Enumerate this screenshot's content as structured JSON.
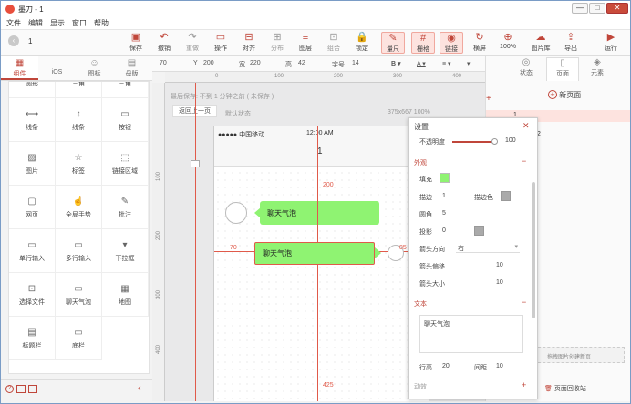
{
  "app": {
    "title": "墨刀 - 1"
  },
  "window_controls": {
    "minimize": "—",
    "maximize": "□",
    "close": "✕"
  },
  "menu": [
    "文件",
    "编辑",
    "显示",
    "窗口",
    "帮助"
  ],
  "nav": {
    "back_icon": "‹",
    "page_number": "1"
  },
  "toolbar": [
    {
      "label": "保存",
      "icon": "▣"
    },
    {
      "label": "撤销",
      "icon": "↶"
    },
    {
      "label": "重做",
      "icon": "↷"
    },
    {
      "label": "操作",
      "icon": "▭"
    },
    {
      "label": "对齐",
      "icon": "⊟"
    },
    {
      "label": "分布",
      "icon": "⊞"
    },
    {
      "label": "图层",
      "icon": "≡"
    },
    {
      "label": "组合",
      "icon": "⊡"
    },
    {
      "label": "锁定",
      "icon": "🔒"
    },
    {
      "label": "量尺",
      "icon": "✎"
    },
    {
      "label": "栅格",
      "icon": "#"
    },
    {
      "label": "链接",
      "icon": "◉"
    },
    {
      "label": "横屏",
      "icon": "↻"
    },
    {
      "label": "100%",
      "icon": "⊕"
    },
    {
      "label": "图片库",
      "icon": "☁"
    },
    {
      "label": "导出",
      "icon": "⇪"
    },
    {
      "label": "运行",
      "icon": "▶"
    }
  ],
  "left_tabs": [
    {
      "label": "组件",
      "icon": "▦"
    },
    {
      "label": "iOS",
      "icon": ""
    },
    {
      "label": "图标",
      "icon": "☺"
    },
    {
      "label": "母版",
      "icon": "▤"
    }
  ],
  "components": [
    {
      "label": "圆形",
      "icon": "○"
    },
    {
      "label": "三角",
      "icon": "△"
    },
    {
      "label": "三角",
      "icon": "▽"
    },
    {
      "label": "线条",
      "icon": "⟷"
    },
    {
      "label": "线条",
      "icon": "↕"
    },
    {
      "label": "按钮",
      "icon": "▭"
    },
    {
      "label": "图片",
      "icon": "▨"
    },
    {
      "label": "标签",
      "icon": "☆"
    },
    {
      "label": "链接区域",
      "icon": "⬚"
    },
    {
      "label": "网页",
      "icon": "▢"
    },
    {
      "label": "全局手势",
      "icon": "☝"
    },
    {
      "label": "批注",
      "icon": "✎"
    },
    {
      "label": "单行输入",
      "icon": "▭"
    },
    {
      "label": "多行输入",
      "icon": "▭"
    },
    {
      "label": "下拉框",
      "icon": "▾"
    },
    {
      "label": "选择文件",
      "icon": "⊡"
    },
    {
      "label": "聊天气泡",
      "icon": "▭"
    },
    {
      "label": "地图",
      "icon": "▦"
    },
    {
      "label": "标题栏",
      "icon": "▤"
    },
    {
      "label": "底栏",
      "icon": "▭"
    }
  ],
  "props": {
    "x": "70",
    "y_label": "Y",
    "y": "200",
    "w_label": "宽",
    "w": "220",
    "h_label": "高",
    "h": "42",
    "font_label": "字号",
    "font": "14"
  },
  "ruler_h_ticks": [
    "0",
    "100",
    "200",
    "300",
    "400"
  ],
  "ruler_v_ticks": [
    "100",
    "200",
    "300",
    "400"
  ],
  "canvas": {
    "saved": "最后保存: 不到 1 分钟之前 ( 未保存 )",
    "back_button": "返回上一页",
    "page_bg": "默认状态",
    "size": "375x667 100%"
  },
  "phone": {
    "signal": "●●●●● 中国移动",
    "time": "12:00 AM",
    "page_title": "1",
    "bubble1": "聊天气泡",
    "bubble2": "聊天气泡",
    "measure_top": "200",
    "measure_left": "70",
    "measure_right": "85",
    "measure_bottom": "425"
  },
  "right_tabs": [
    {
      "label": "状态",
      "icon": "◎"
    },
    {
      "label": "页面",
      "icon": "▯"
    },
    {
      "label": "元素",
      "icon": "◈"
    }
  ],
  "pages": {
    "new_page": "新页面",
    "item_1": "1",
    "item_2": "2"
  },
  "settings": {
    "title": "设置",
    "opacity_label": "不透明度",
    "opacity": "100",
    "appearance": "外观",
    "fill_label": "填充",
    "stroke_label": "描边",
    "stroke": "1",
    "stroke_color_label": "描边色",
    "radius_label": "圆角",
    "radius": "5",
    "shadow_label": "投影",
    "shadow": "0",
    "arrow_dir_label": "箭头方向",
    "arrow_dir": "右",
    "arrow_offset_label": "箭头偏移",
    "arrow_offset": "10",
    "arrow_size_label": "箭头大小",
    "arrow_size": "10",
    "text_section": "文本",
    "text_value": "聊天气泡",
    "line_height_label": "行高",
    "line_height": "20",
    "spacing_label": "间距",
    "spacing": "10",
    "effects": "动效"
  },
  "right_bottom": {
    "upload_hint": "拖拽图片创建新页",
    "recycle": "页面回收站"
  },
  "colors": {
    "accent": "#c0463a",
    "bubble": "#8ff372",
    "guide": "#e05a4a"
  }
}
